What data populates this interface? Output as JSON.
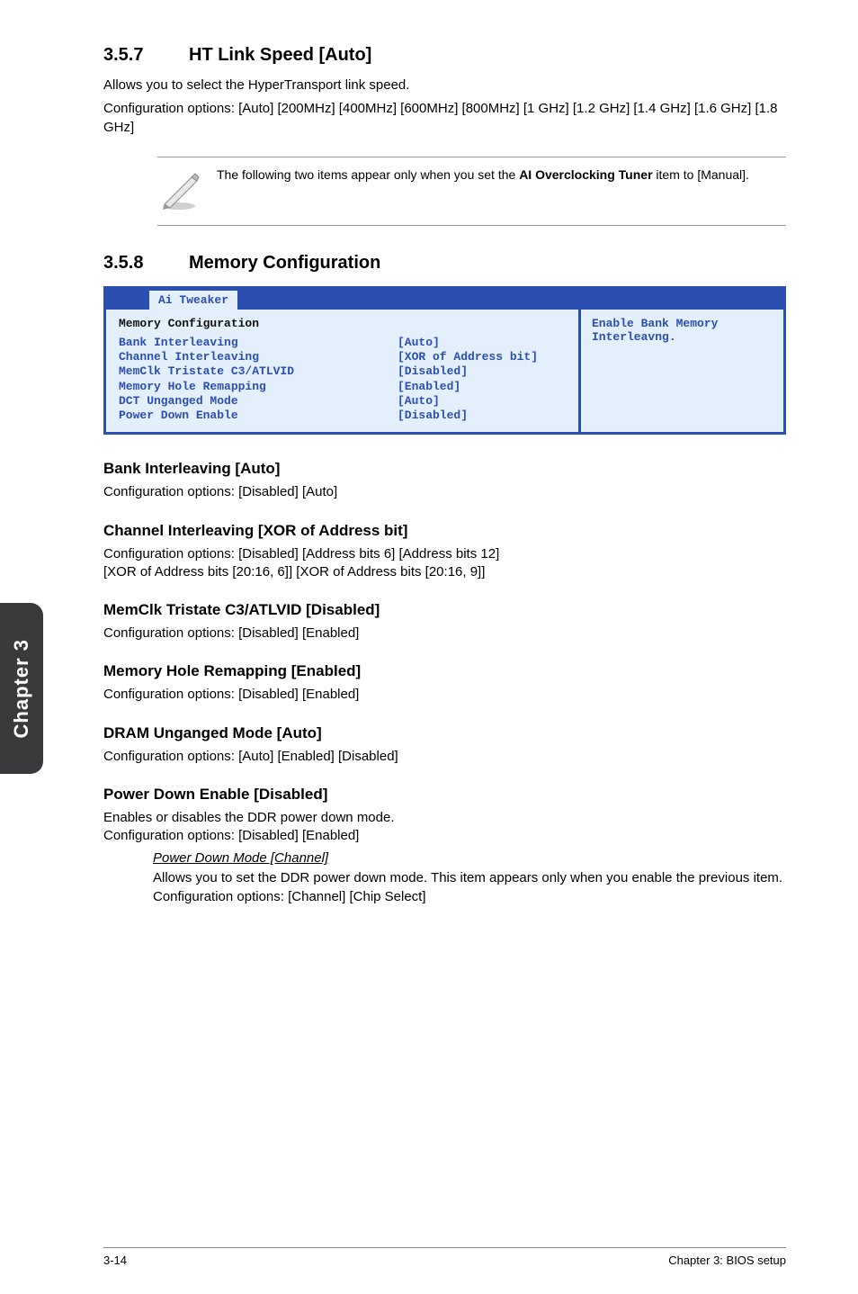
{
  "section1": {
    "num": "3.5.7",
    "title": "HT Link Speed [Auto]",
    "body1": "Allows you to select the HyperTransport link speed.",
    "body2": "Configuration options: [Auto] [200MHz] [400MHz] [600MHz] [800MHz] [1 GHz] [1.2 GHz] [1.4 GHz] [1.6 GHz] [1.8 GHz]"
  },
  "note": {
    "text_pre": "The following two items appear only when you set the ",
    "bold": "AI Overclocking Tuner",
    "text_post": " item to [Manual]."
  },
  "section2": {
    "num": "3.5.8",
    "title": "Memory Configuration"
  },
  "bios": {
    "tab": "Ai Tweaker",
    "heading": "Memory Configuration",
    "items": [
      {
        "label": "Bank Interleaving",
        "val": "[Auto]"
      },
      {
        "label": "Channel Interleaving",
        "val": "[XOR of Address bit]"
      },
      {
        "label": "MemClk Tristate C3/ATLVID",
        "val": "[Disabled]"
      },
      {
        "label": "Memory Hole Remapping",
        "val": "[Enabled]"
      },
      {
        "label": "DCT Unganged Mode",
        "val": "[Auto]"
      },
      {
        "label": "Power Down Enable",
        "val": "[Disabled]"
      }
    ],
    "help": "Enable Bank Memory Interleavng."
  },
  "subs": {
    "bank": {
      "title": "Bank Interleaving [Auto]",
      "body": "Configuration options: [Disabled] [Auto]"
    },
    "channel": {
      "title": "Channel Interleaving [XOR of Address bit]",
      "body1": "Configuration options: [Disabled] [Address bits 6] [Address bits 12]",
      "body2": "[XOR of Address bits [20:16, 6]] [XOR of Address bits [20:16, 9]]"
    },
    "memclk": {
      "title": "MemClk Tristate C3/ATLVID [Disabled]",
      "body": "Configuration options: [Disabled] [Enabled]"
    },
    "hole": {
      "title": "Memory Hole Remapping [Enabled]",
      "body": "Configuration options: [Disabled] [Enabled]"
    },
    "dram": {
      "title": "DRAM Unganged Mode [Auto]",
      "body": "Configuration options: [Auto] [Enabled] [Disabled]"
    },
    "power": {
      "title": "Power Down Enable [Disabled]",
      "body1": "Enables or disables the DDR power down mode.",
      "body2": "Configuration options: [Disabled] [Enabled]",
      "sub_title": "Power Down Mode [Channel]",
      "sub_body": "Allows you to set the DDR power down mode. This item appears only when you enable the previous item. Configuration options: [Channel] [Chip Select]"
    }
  },
  "sidebar": "Chapter 3",
  "footer": {
    "left": "3-14",
    "right": "Chapter 3: BIOS setup"
  }
}
